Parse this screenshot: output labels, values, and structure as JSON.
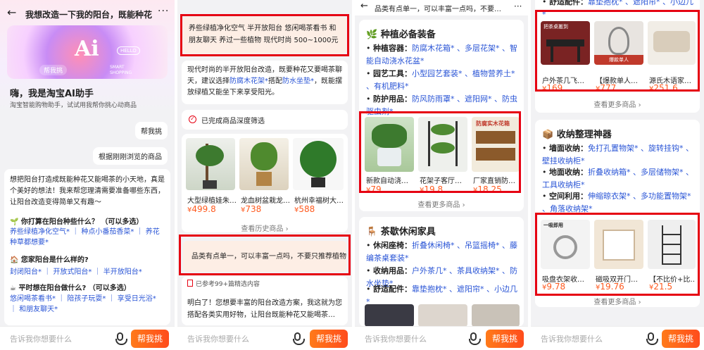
{
  "colors": {
    "accent": "#ff5a1f",
    "link": "#2a55d6",
    "highlight": "#e60012"
  },
  "bottom": {
    "placeholder": "告诉我你想要什么",
    "button": "帮我挑",
    "mic_icon": "microphone-icon"
  },
  "p1": {
    "title": "我想改造一下我的阳台，既能种花又能…",
    "back_icon": "back-arrow-icon",
    "more_icon": "more-dots-icon",
    "banner": {
      "logo": "Ai",
      "hello": "HELLO",
      "help": "帮我挑",
      "tag1": "SMART",
      "tag2": "SHOPPING"
    },
    "greeting": "嗨，我是淘宝AI助手",
    "subtitle": "淘宝智能购物助手，试试用我帮你挑心动商品",
    "user_msg1": "帮我挑",
    "user_msg2": "根据刚刚浏览的商品",
    "intro": "想把阳台打造成既能种花又能喝茶的小天地，真是个美好的想法！我来帮您理清需要准备哪些东西，让阳台改造变得简单又有趣～",
    "q1": "🌱 你打算在阳台种些什么？ （可以多选）",
    "q1_opts": "养些绿植净化空气* ｜ 种点小番茄香菜* ｜ 养花种草都想要*",
    "q2": "🏠 您家阳台是什么样的?",
    "q2_opts": "封闭阳台* ｜ 开放式阳台* ｜ 半开放阳台*",
    "q3": "☕ 平时想在阳台做什么? （可以多选）",
    "q3_opts": "悠闲喝茶看书* ｜ 陪孩子玩耍* ｜ 享受日光浴* ｜ 和朋友聊天*"
  },
  "p2": {
    "user_choice": "养些绿植净化空气 半开放阳台 悠闲喝茶看书 和朋友聊天 养过一些植物 现代时尚 500~1000元",
    "summary_a": "现代时尚的半开放阳台改造，既要种花又要喝茶聊天，建议选择",
    "summary_link1": "防腐木花架*",
    "summary_b": "搭配",
    "summary_link2": "防水坐垫*",
    "summary_c": "，既能摆放绿植又能坐下来享受阳光。",
    "filter_done": "已完成商品深度筛选",
    "products": [
      {
        "name": "大型绿植娃朱…",
        "price": "499.8"
      },
      {
        "name": "龙血树盆栽龙…",
        "price": "738"
      },
      {
        "name": "杭州幸福树大…",
        "price": "588"
      }
    ],
    "view_history": "查看历史商品",
    "user_msg": "品类有点单一，可以丰富一点吗，不要只推荐植物",
    "ref_count": "已参考99+篇精选内容",
    "answer": "明白了！您想要丰富的阳台改造方案，我这就为您搭配各类实用好物，让阳台既能种花又能喝茶…"
  },
  "p3": {
    "header": "品类有点单一，可以丰富一点吗，不要…",
    "s1": {
      "title": "种植必备装备",
      "r1k": "种植容器：",
      "r1": "防腐木花箱* 、多层花架* 、智能自动浇水花盆*",
      "r2k": "园艺工具：",
      "r2": "小型园艺套装* 、植物营养土* 、有机肥料*",
      "r3k": "防护用品：",
      "r3": "防风防雨罩* 、遮阳网* 、防虫驱虫剂*"
    },
    "products": [
      {
        "name": "新款自动浇…",
        "price": "79"
      },
      {
        "name": "花架子客厅…",
        "price": "19.8"
      },
      {
        "name": "厂家直销防…",
        "price": "18.25"
      }
    ],
    "more": "查看更多商品",
    "s2": {
      "title": "茶歇休闲家具",
      "r1k": "休闲座椅：",
      "r1": "折叠休闲椅* 、吊篮摇椅* 、藤编茶桌套装*",
      "r2k": "收纳用品：",
      "r2": "户外茶几* 、茶具收纳架* 、防水坐垫*",
      "r3k": "舒适配件：",
      "r3": "靠垫抱枕* 、遮阳帘* 、小边几*"
    }
  },
  "p4": {
    "top_line_k": "舒适配件：",
    "top_line": "靠垫抱枕* 、遮阳帘* 、小边几*",
    "products1": [
      {
        "name": "户外茶几飞…",
        "price": "169"
      },
      {
        "name": "【爆款单人…",
        "price": "777"
      },
      {
        "name": "源氏木语家…",
        "price": "251.6"
      }
    ],
    "more1": "查看更多商品",
    "s3": {
      "title": "收纳整理神器",
      "r1k": "墙面收纳：",
      "r1": "免打孔置物架* 、旋转挂钩* 、壁挂收纳柜*",
      "r2k": "地面收纳：",
      "r2": "折叠收纳箱* 、多层储物架* 、工具收纳柜*",
      "r3k": "空间利用：",
      "r3": "伸缩晾衣架* 、多功能置物架* 、角落收纳架*"
    },
    "products2": [
      {
        "name": "吸盘衣架收…",
        "price": "9.78"
      },
      {
        "name": "磁吸双开门…",
        "price": "19.76"
      },
      {
        "name": "【不比价+比…",
        "price": "21.5"
      }
    ],
    "more2": "查看更多商品"
  }
}
